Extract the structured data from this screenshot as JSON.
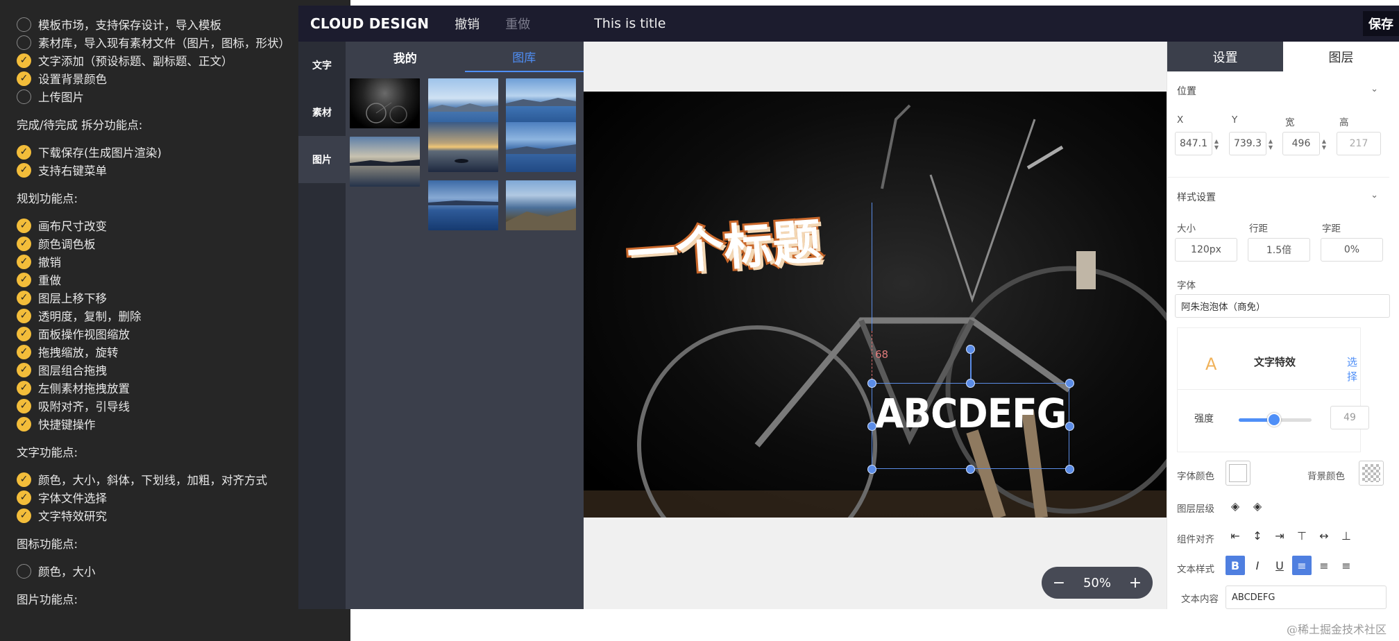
{
  "checklist": {
    "group1": [
      {
        "text": "模板市场，支持保存设计，导入模板",
        "done": false
      },
      {
        "text": "素材库，导入现有素材文件（图片，图标，形状）",
        "done": false
      },
      {
        "text": "文字添加（预设标题、副标题、正文）",
        "done": true
      },
      {
        "text": "设置背景颜色",
        "done": true
      },
      {
        "text": "上传图片",
        "done": false
      }
    ],
    "heading2": "完成/待完成 拆分功能点:",
    "group2": [
      {
        "text": "下载保存(生成图片渲染)",
        "done": true
      },
      {
        "text": "支持右键菜单",
        "done": true
      }
    ],
    "heading3": "规划功能点:",
    "group3": [
      {
        "text": "画布尺寸改变",
        "done": true
      },
      {
        "text": "颜色调色板",
        "done": true
      },
      {
        "text": "撤销",
        "done": true
      },
      {
        "text": "重做",
        "done": true
      },
      {
        "text": "图层上移下移",
        "done": true
      },
      {
        "text": "透明度，复制，删除",
        "done": true
      },
      {
        "text": "面板操作视图缩放",
        "done": true
      },
      {
        "text": "拖拽缩放，旋转",
        "done": true
      },
      {
        "text": "图层组合拖拽",
        "done": true
      },
      {
        "text": "左侧素材拖拽放置",
        "done": true
      },
      {
        "text": "吸附对齐，引导线",
        "done": true
      },
      {
        "text": "快捷键操作",
        "done": true
      }
    ],
    "heading4": "文字功能点:",
    "group4": [
      {
        "text": "颜色，大小，斜体，下划线，加粗，对齐方式",
        "done": true
      },
      {
        "text": "字体文件选择",
        "done": true
      },
      {
        "text": "文字特效研究",
        "done": true
      }
    ],
    "heading5": "图标功能点:",
    "group5": [
      {
        "text": "颜色，大小",
        "done": false
      }
    ],
    "heading6": "图片功能点:"
  },
  "topbar": {
    "brand": "CLOUD DESIGN",
    "undo": "撤销",
    "redo": "重做",
    "title": "This is title",
    "save": "保存"
  },
  "sidetabs": [
    "文字",
    "素材",
    "图片"
  ],
  "materials": {
    "tab_mine": "我的",
    "tab_gallery": "图库"
  },
  "canvas": {
    "title_text": "一个标题",
    "text_box": "ABCDEFG",
    "guide_distance": "68",
    "zoom": "50%",
    "zoom_minus": "−",
    "zoom_plus": "+"
  },
  "panel": {
    "tab_settings": "设置",
    "tab_layers": "图层",
    "position": {
      "section": "位置",
      "x_label": "X",
      "x": "847.1",
      "y_label": "Y",
      "y": "739.3",
      "w_label": "宽",
      "w": "496",
      "h_label": "高",
      "h": "217"
    },
    "style": {
      "section": "样式设置",
      "size_label": "大小",
      "size": "120px",
      "line_label": "行距",
      "line": "1.5倍",
      "spacing_label": "字距",
      "spacing": "0%",
      "font_label": "字体",
      "font": "阿朱泡泡体（商免）"
    },
    "effect": {
      "title": "文字特效",
      "choose": "选择",
      "strength_label": "强度",
      "strength": "49",
      "strength_fraction": 0.49
    },
    "font_color_label": "字体颜色",
    "bg_color_label": "背景颜色",
    "layer_label": "图层层级",
    "align_label": "组件对齐",
    "text_style_label": "文本样式",
    "text_style": {
      "bold": "B",
      "italic": "I",
      "underline": "U"
    },
    "content_label": "文本内容",
    "content": "ABCDEFG"
  },
  "watermark": "@稀土掘金技术社区",
  "colors": {
    "accent": "#4f8ff7",
    "check": "#f3bd3a",
    "topbar": "#1c1c2e"
  }
}
